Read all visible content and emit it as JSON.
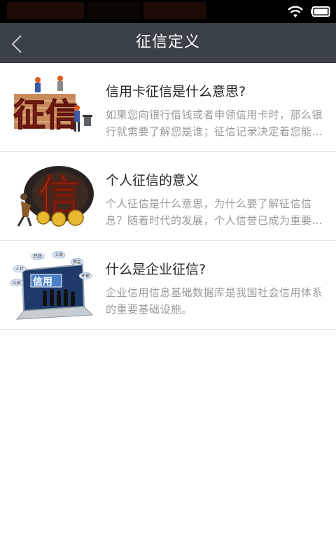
{
  "nav": {
    "title": "征信定义"
  },
  "articles": [
    {
      "title": "信用卡征信是什么意思?",
      "summary": "如果您向银行借钱或者申领信用卡时，那么银行就需要了解您是谁；征信记录决定着您能否顺利借到钱。",
      "image_text": "征信",
      "image": "credit-report-construction-illustration"
    },
    {
      "title": "个人征信的意义",
      "summary": "个人征信是什么意思，为什么要了解征信信息？随着时代的发展，个人信誉已成为重要的财富。",
      "image_text": "信",
      "image": "personal-credit-coins-illustration"
    },
    {
      "title": "什么是企业征信?",
      "summary": "企业信用信息基础数据库是我国社会信用体系的重要基础设施。",
      "image_text": "信用",
      "image_labels": [
        "民政",
        "工商",
        "质监",
        "人社",
        "环保",
        "公安"
      ],
      "image": "enterprise-credit-laptop-illustration"
    }
  ],
  "colors": {
    "navbar": "#3a4148",
    "title_text": "#222222",
    "summary_text": "#9a9a9a",
    "divider": "#e6e6e6"
  }
}
